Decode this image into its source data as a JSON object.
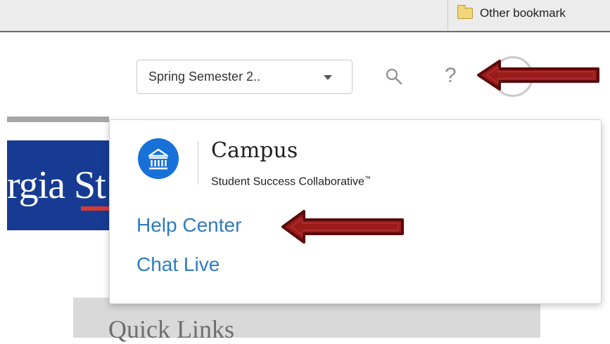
{
  "bookmarks_bar": {
    "items": [
      {
        "label": "Other bookmark",
        "icon": "folder-icon"
      }
    ]
  },
  "header": {
    "term_select": {
      "selected": "Spring Semester 2..",
      "icon": "chevron-down-icon"
    },
    "search": {
      "icon": "search-icon"
    },
    "help": {
      "glyph": "?",
      "icon": "help-icon"
    }
  },
  "page": {
    "school_banner": "rgia St",
    "quick_links": {
      "title": "Quick Links"
    }
  },
  "help_menu": {
    "brand": {
      "name": "Campus",
      "tagline": "Student Success Collaborative",
      "trademark": "™",
      "logo_icon": "building-icon"
    },
    "links": [
      {
        "label": "Help Center"
      },
      {
        "label": "Chat Live"
      }
    ]
  },
  "colors": {
    "accent": "#2f7bbf",
    "logo_blue": "#1771d8",
    "banner_blue": "#173b93",
    "annotation_red": "#9b1b1b"
  }
}
